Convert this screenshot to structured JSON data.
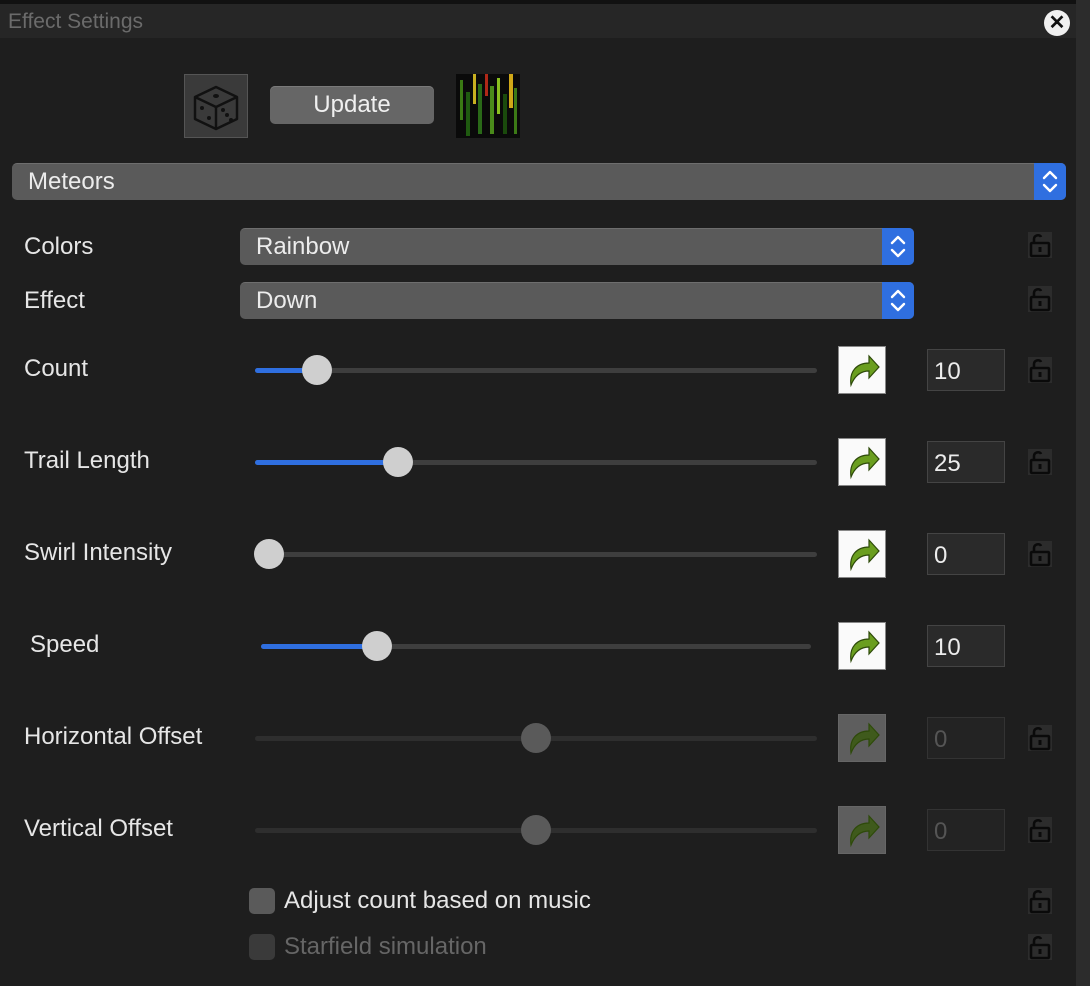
{
  "window": {
    "title": "Effect Settings"
  },
  "toolbar": {
    "update_label": "Update"
  },
  "effect_select": {
    "value": "Meteors"
  },
  "rows": {
    "colors": {
      "label": "Colors",
      "value": "Rainbow"
    },
    "effect": {
      "label": "Effect",
      "value": "Down"
    }
  },
  "sliders": [
    {
      "label": "Count",
      "value": "10",
      "level": 0.11,
      "enabled": true
    },
    {
      "label": "Trail Length",
      "value": "25",
      "level": 0.255,
      "enabled": true
    },
    {
      "label": "Swirl Intensity",
      "value": "0",
      "level": 0.0,
      "enabled": true
    },
    {
      "label": "Speed",
      "value": "10",
      "level": 0.21,
      "enabled": true
    },
    {
      "label": "Horizontal Offset",
      "value": "0",
      "level": 0.5,
      "enabled": false
    },
    {
      "label": "Vertical Offset",
      "value": "0",
      "level": 0.5,
      "enabled": false
    }
  ],
  "checkboxes": [
    {
      "label": "Adjust count based on music",
      "checked": false,
      "enabled": true
    },
    {
      "label": "Starfield simulation",
      "checked": false,
      "enabled": false
    }
  ],
  "colors": {
    "accent": "#2f6fe0",
    "background": "#1e1e1e",
    "reset_arrow": "#6a9e1f"
  },
  "icons": {
    "close": "close-icon",
    "randomize": "dice-icon",
    "lock": "lock-icon",
    "reset": "reset-arrow-icon"
  }
}
